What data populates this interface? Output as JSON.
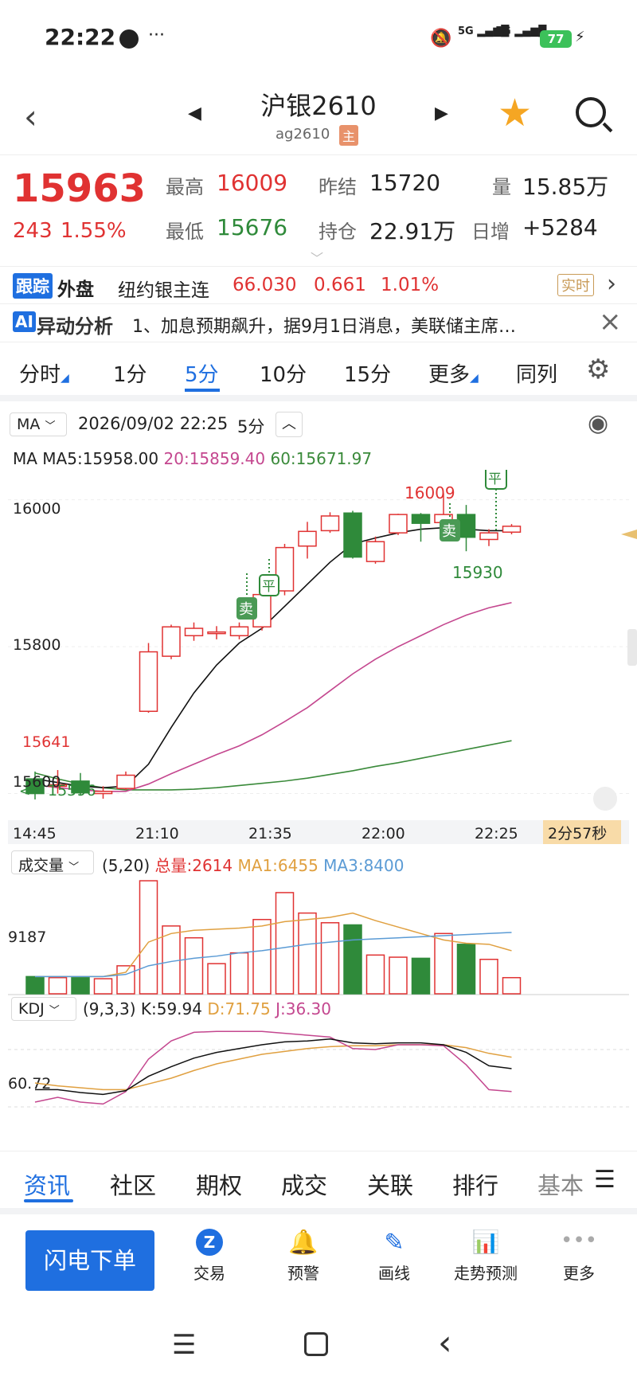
{
  "status": {
    "time": "22:22",
    "dots": "···",
    "battery": "77",
    "net1": "5G",
    "net2": "5G"
  },
  "header": {
    "title": "沪银2610",
    "code": "ag2610",
    "main_badge": "主"
  },
  "quote": {
    "price": "15963",
    "change": "243",
    "change_pct": "1.55%",
    "high_label": "最高",
    "high": "16009",
    "low_label": "最低",
    "low": "15676",
    "prev_label": "昨结",
    "prev": "15720",
    "oi_label": "持仓",
    "oi": "22.91万",
    "vol_label": "量",
    "vol": "15.85万",
    "daily_label": "日增",
    "daily": "+5284"
  },
  "track": {
    "badge1": "跟踪",
    "badge2": "外盘",
    "name": "纽约银主连",
    "price": "66.030",
    "change": "0.661",
    "pct": "1.01%",
    "realtime": "实时"
  },
  "ai": {
    "badge": "AI",
    "title": "异动分析",
    "text": "1、加息预期飙升，据9月1日消息，美联储主席…"
  },
  "periods": {
    "items": [
      "分时",
      "1分",
      "5分",
      "10分",
      "15分",
      "更多",
      "同列"
    ],
    "active_index": 2
  },
  "chart_header": {
    "indicator": "MA",
    "datetime": "2026/09/02 22:25",
    "period": "5分"
  },
  "ma_line": {
    "label": "MA",
    "ma5": "MA5:15958.00",
    "ma20": "20:15859.40",
    "ma60": "60:15671.97"
  },
  "axis": {
    "y_labels": [
      "16000",
      "15800",
      "15600"
    ],
    "x_labels": [
      "14:45",
      "21:10",
      "21:35",
      "22:00",
      "22:25"
    ],
    "countdown": "2分57秒"
  },
  "annotations": {
    "high": "16009",
    "low_local": "15930",
    "left_high": "15641",
    "left_low": "15596",
    "sell": "卖",
    "flat": "平"
  },
  "volume": {
    "title": "成交量",
    "params": "(5,20)",
    "total": "总量:2614",
    "ma1": "MA1:6455",
    "ma3": "MA3:8400",
    "level": "9187"
  },
  "kdj": {
    "title": "KDJ",
    "params": "(9,3,3)",
    "k": "K:59.94",
    "d": "D:71.75",
    "j": "J:36.30",
    "level": "60.72"
  },
  "tabs": {
    "items": [
      "资讯",
      "社区",
      "期权",
      "成交",
      "关联",
      "排行",
      "基本"
    ],
    "active_index": 0
  },
  "bottom": {
    "flash": "闪电下单",
    "items": [
      "交易",
      "预警",
      "画线",
      "走势预测",
      "更多"
    ]
  },
  "colors": {
    "up": "#e03232",
    "down": "#2f8a3a",
    "accent": "#1f6fe0",
    "ma5": "#111111",
    "ma20": "#c4478f",
    "ma60": "#3a8a3a",
    "ma1": "#e0a040",
    "ma3": "#5b9bd5"
  },
  "chart_data": {
    "type": "candlestick",
    "y_range": [
      15580,
      16030
    ],
    "candles": [
      {
        "o": 15620,
        "c": 15600,
        "h": 15630,
        "l": 15592
      },
      {
        "o": 15612,
        "c": 15612,
        "h": 15632,
        "l": 15600
      },
      {
        "o": 15617,
        "c": 15601,
        "h": 15628,
        "l": 15598
      },
      {
        "o": 15600,
        "c": 15603,
        "h": 15610,
        "l": 15593
      },
      {
        "o": 15607,
        "c": 15625,
        "h": 15630,
        "l": 15605
      },
      {
        "o": 15712,
        "c": 15793,
        "h": 15805,
        "l": 15710
      },
      {
        "o": 15787,
        "c": 15827,
        "h": 15830,
        "l": 15783
      },
      {
        "o": 15815,
        "c": 15825,
        "h": 15833,
        "l": 15808
      },
      {
        "o": 15820,
        "c": 15820,
        "h": 15828,
        "l": 15810
      },
      {
        "o": 15815,
        "c": 15827,
        "h": 15833,
        "l": 15810
      },
      {
        "o": 15827,
        "c": 15871,
        "h": 15873,
        "l": 15822
      },
      {
        "o": 15876,
        "c": 15935,
        "h": 15940,
        "l": 15870
      },
      {
        "o": 15937,
        "c": 15957,
        "h": 15970,
        "l": 15920
      },
      {
        "o": 15958,
        "c": 15978,
        "h": 15983,
        "l": 15955
      },
      {
        "o": 15982,
        "c": 15922,
        "h": 15985,
        "l": 15920
      },
      {
        "o": 15916,
        "c": 15943,
        "h": 15950,
        "l": 15913
      },
      {
        "o": 15955,
        "c": 15980,
        "h": 15981,
        "l": 15952
      },
      {
        "o": 15980,
        "c": 15968,
        "h": 15982,
        "l": 15943
      },
      {
        "o": 15969,
        "c": 15980,
        "h": 16009,
        "l": 15967
      },
      {
        "o": 15980,
        "c": 15949,
        "h": 15993,
        "l": 15930
      },
      {
        "o": 15946,
        "c": 15955,
        "h": 15960,
        "l": 15937
      },
      {
        "o": 15956,
        "c": 15964,
        "h": 15967,
        "l": 15953
      }
    ],
    "ma5": [
      15620,
      15615,
      15610,
      15608,
      15610,
      15640,
      15690,
      15737,
      15775,
      15805,
      15825,
      15855,
      15885,
      15915,
      15940,
      15948,
      15955,
      15960,
      15962,
      15960,
      15958,
      15958
    ],
    "ma20": [
      15612,
      15608,
      15605,
      15603,
      15603,
      15613,
      15627,
      15640,
      15653,
      15665,
      15680,
      15698,
      15717,
      15740,
      15763,
      15783,
      15800,
      15815,
      15830,
      15843,
      15853,
      15860
    ],
    "ma60": [
      15628,
      15620,
      15613,
      15608,
      15605,
      15605,
      15605,
      15606,
      15608,
      15611,
      15614,
      15617,
      15621,
      15626,
      15631,
      15637,
      15642,
      15648,
      15654,
      15660,
      15666,
      15672
    ],
    "volume": [
      1600,
      1500,
      1500,
      1400,
      2600,
      10500,
      6300,
      5200,
      2800,
      3800,
      6900,
      9400,
      7500,
      6600,
      6400,
      3600,
      3400,
      3300,
      5600,
      4600,
      3200,
      1500
    ],
    "volume_range": [
      0,
      10800
    ],
    "vol_ma1": [
      1600,
      1600,
      1600,
      1600,
      2000,
      4800,
      5600,
      5900,
      6000,
      6100,
      6300,
      6700,
      6900,
      7100,
      7500,
      6800,
      6200,
      5600,
      5000,
      4700,
      4600,
      4000
    ],
    "vol_ma3": [
      1600,
      1600,
      1600,
      1600,
      1800,
      2600,
      3000,
      3300,
      3500,
      3800,
      4000,
      4300,
      4600,
      4800,
      5000,
      5100,
      5200,
      5300,
      5400,
      5500,
      5600,
      5700
    ],
    "kdj_range": [
      0,
      100
    ],
    "k": [
      38,
      38,
      35,
      33,
      37,
      52,
      62,
      71,
      77,
      81,
      85,
      88,
      89,
      91,
      87,
      86,
      87,
      87,
      85,
      77,
      63,
      60
    ],
    "d": [
      45,
      42,
      40,
      38,
      38,
      44,
      50,
      58,
      65,
      70,
      75,
      78,
      81,
      83,
      84,
      84,
      85,
      85,
      85,
      82,
      76,
      72
    ],
    "j": [
      25,
      30,
      25,
      23,
      36,
      70,
      89,
      98,
      99,
      99,
      99,
      97,
      95,
      93,
      81,
      80,
      85,
      85,
      84,
      64,
      38,
      36
    ]
  }
}
